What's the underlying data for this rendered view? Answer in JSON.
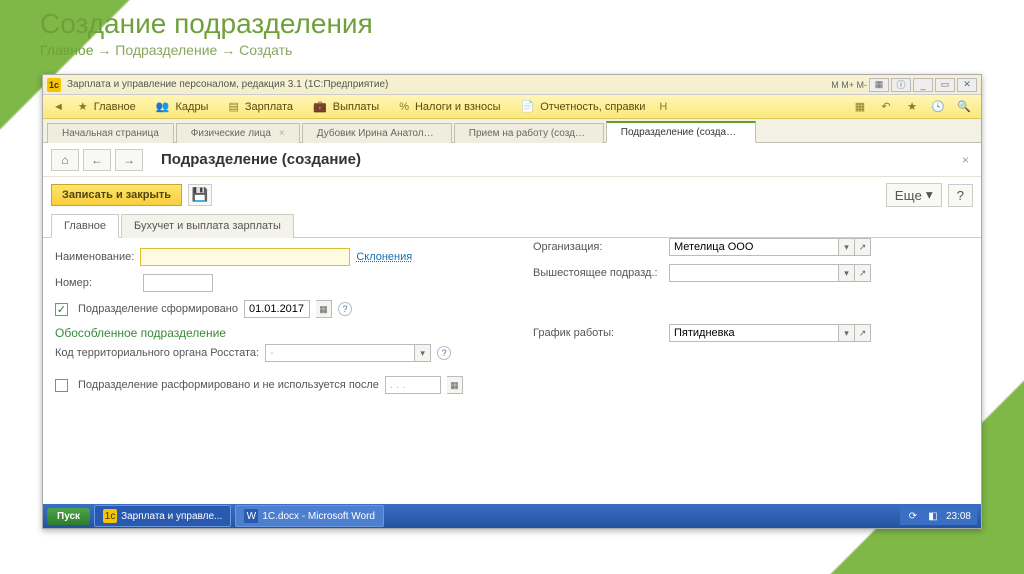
{
  "slide": {
    "title": "Создание подразделения",
    "breadcrumb": {
      "a": "Главное",
      "arrow": "→",
      "b": "Подразделение",
      "c": "Создать"
    }
  },
  "window": {
    "title": "Зарплата и управление персоналом, редакция 3.1  (1С:Предприятие)",
    "mem": "M  M+  M-"
  },
  "menu": {
    "items": [
      "Главное",
      "Кадры",
      "Зарплата",
      "Выплаты",
      "%",
      "Налоги и взносы",
      "Отчетность, справки"
    ],
    "nav_left": "Н"
  },
  "doc_tabs": {
    "t1": "Начальная страница",
    "t2": "Физические лица",
    "t3": "Дубовик Ирина Анатольевна...",
    "t4": "Прием на работу (создание) *",
    "t5": "Подразделение (создание)"
  },
  "page": {
    "title": "Подразделение (создание)",
    "save_close": "Записать и закрыть",
    "more": "Еще"
  },
  "form_tabs": {
    "a": "Главное",
    "b": "Бухучет и выплата зарплаты"
  },
  "form": {
    "name_label": "Наименование:",
    "declensions": "Склонения",
    "number_label": "Номер:",
    "formed_label": "Подразделение сформировано",
    "formed_date": "01.01.2017",
    "org_label": "Организация:",
    "org_value": "Метелица ООО",
    "parent_label": "Вышестоящее подразд.:",
    "separate_title": "Обособленное подразделение",
    "rosstat_label": "Код территориального органа Росстата:",
    "schedule_label": "График работы:",
    "schedule_value": "Пятидневка",
    "disbanded_label": "Подразделение расформировано и не используется после",
    "disbanded_date": ". . ."
  },
  "taskbar": {
    "start": "Пуск",
    "app1": "Зарплата и управле...",
    "app2": "1С.docx - Microsoft Word",
    "time": "23:08"
  }
}
